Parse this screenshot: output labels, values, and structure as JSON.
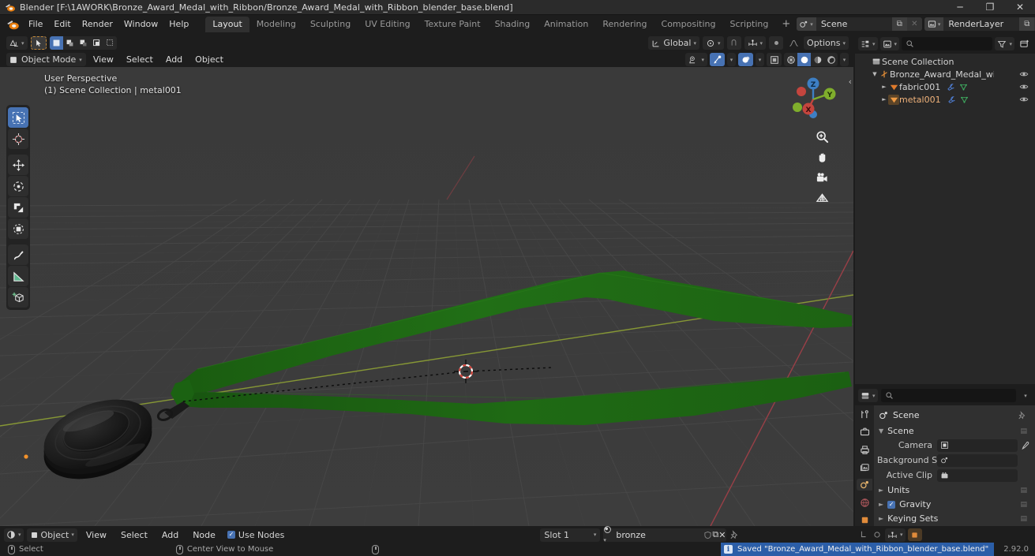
{
  "window": {
    "title": "Blender [F:\\1AWORK\\Bronze_Award_Medal_with_Ribbon/Bronze_Award_Medal_with_Ribbon_blender_base.blend]",
    "minimize": "─",
    "maximize": "❐",
    "close": "✕"
  },
  "topbar": {
    "menus": [
      "File",
      "Edit",
      "Render",
      "Window",
      "Help"
    ],
    "workspaces": [
      {
        "label": "Layout",
        "active": true
      },
      {
        "label": "Modeling",
        "active": false
      },
      {
        "label": "Sculpting",
        "active": false
      },
      {
        "label": "UV Editing",
        "active": false
      },
      {
        "label": "Texture Paint",
        "active": false
      },
      {
        "label": "Shading",
        "active": false
      },
      {
        "label": "Animation",
        "active": false
      },
      {
        "label": "Rendering",
        "active": false
      },
      {
        "label": "Compositing",
        "active": false
      },
      {
        "label": "Scripting",
        "active": false
      }
    ],
    "add_workspace": "+",
    "scene_name": "Scene",
    "view_layer_name": "RenderLayer",
    "new_copy_glyph": "⧉",
    "unlink_glyph": "✕"
  },
  "viewport": {
    "header": {
      "editor_type": "editor-type-3dview",
      "mode": "Object Mode",
      "menus": [
        "View",
        "Select",
        "Add",
        "Object"
      ],
      "transform_orientation": "Global",
      "options_label": "Options",
      "proportional_label": "proportional-editing",
      "snap_label": "snapping"
    },
    "overlay": {
      "perspective": "User Perspective",
      "collection_info": "(1) Scene Collection | metal001"
    },
    "tools": [
      {
        "name": "tool-select-box",
        "active": true
      },
      {
        "name": "tool-cursor",
        "active": false
      },
      {
        "name": "tool-move",
        "active": false
      },
      {
        "name": "tool-rotate",
        "active": false
      },
      {
        "name": "tool-scale",
        "active": false
      },
      {
        "name": "tool-transform",
        "active": false
      },
      {
        "name": "tool-annotate",
        "active": false
      },
      {
        "name": "tool-measure",
        "active": false
      },
      {
        "name": "tool-add-cube",
        "active": false
      }
    ],
    "gizmo_axes": [
      {
        "label": "Z",
        "color": "#2f83e3"
      },
      {
        "label": "Y",
        "color": "#8bc727"
      },
      {
        "label": "X",
        "color": "#e3544a"
      }
    ],
    "nav_buttons": [
      "zoom-icon",
      "hand-icon",
      "camera-icon",
      "grid-icon"
    ],
    "colors": {
      "background": "#3b3b3b",
      "grid_line": "#4b4b4b",
      "axis_x": "#a7444a",
      "axis_y": "#87a02f",
      "ribbon_green": "#1e6a14",
      "ribbon_green_dark": "#175610",
      "medal_black": "#151515"
    }
  },
  "outliner": {
    "search_placeholder": "",
    "display_mode": "view-layer",
    "filter_icon": "filter-icon",
    "rows": [
      {
        "label": "Scene Collection",
        "indent": 0,
        "icon": "collection-icon",
        "expanded": true,
        "eye": false
      },
      {
        "label": "Bronze_Award_Medal_with_Ribbo",
        "indent": 1,
        "icon": "empty-axes-icon",
        "expanded": true,
        "eye": true
      },
      {
        "label": "fabric001",
        "indent": 2,
        "icon": "mesh-icon",
        "expanded": false,
        "eye": true,
        "modifier": true
      },
      {
        "label": "metal001",
        "indent": 2,
        "icon": "mesh-icon",
        "expanded": false,
        "eye": true,
        "modifier": true,
        "selected": true
      }
    ]
  },
  "properties": {
    "search_placeholder": "",
    "tabs": [
      {
        "name": "tool-properties-tab",
        "active": false
      },
      {
        "name": "render-properties-tab",
        "active": false
      },
      {
        "name": "output-properties-tab",
        "active": false
      },
      {
        "name": "view-layer-properties-tab",
        "active": false
      },
      {
        "name": "scene-properties-tab",
        "active": true
      },
      {
        "name": "world-properties-tab",
        "active": false
      },
      {
        "name": "object-properties-tab",
        "active": false
      }
    ],
    "breadcrumb": "Scene",
    "panels": [
      {
        "label": "Scene",
        "open": true
      },
      {
        "label": "Units",
        "open": false
      },
      {
        "label": "Gravity",
        "open": false,
        "checked": true
      },
      {
        "label": "Keying Sets",
        "open": false
      }
    ],
    "fields": [
      {
        "label": "Camera",
        "value": "",
        "icon": "camera-icon",
        "eyedropper": true
      },
      {
        "label": "Background Sce...",
        "value": "",
        "icon": "scene-icon",
        "eyedropper": false
      },
      {
        "label": "Active Clip",
        "value": "",
        "icon": "clip-icon",
        "eyedropper": false
      }
    ]
  },
  "shader_editor": {
    "editor_type": "editor-type-shader",
    "shader_type": "Object",
    "menus": [
      "View",
      "Select",
      "Add",
      "Node"
    ],
    "use_nodes_label": "Use Nodes",
    "use_nodes_checked": true,
    "slot_label": "Slot 1",
    "material_name": "bronze",
    "fake_user_glyph": "⛉",
    "new_material_glyph": "⧉",
    "unlink_glyph": "✕",
    "pin_glyph": "pin-icon"
  },
  "statusbar": {
    "hints": [
      {
        "icon": "mouse-left-icon",
        "label": "Select"
      },
      {
        "icon": "mouse-middle-icon",
        "label": "Center View to Mouse"
      },
      {
        "icon": "mouse-right-icon",
        "label": ""
      }
    ],
    "report": "Saved \"Bronze_Award_Medal_with_Ribbon_blender_base.blend\"",
    "version": "2.92.0"
  }
}
